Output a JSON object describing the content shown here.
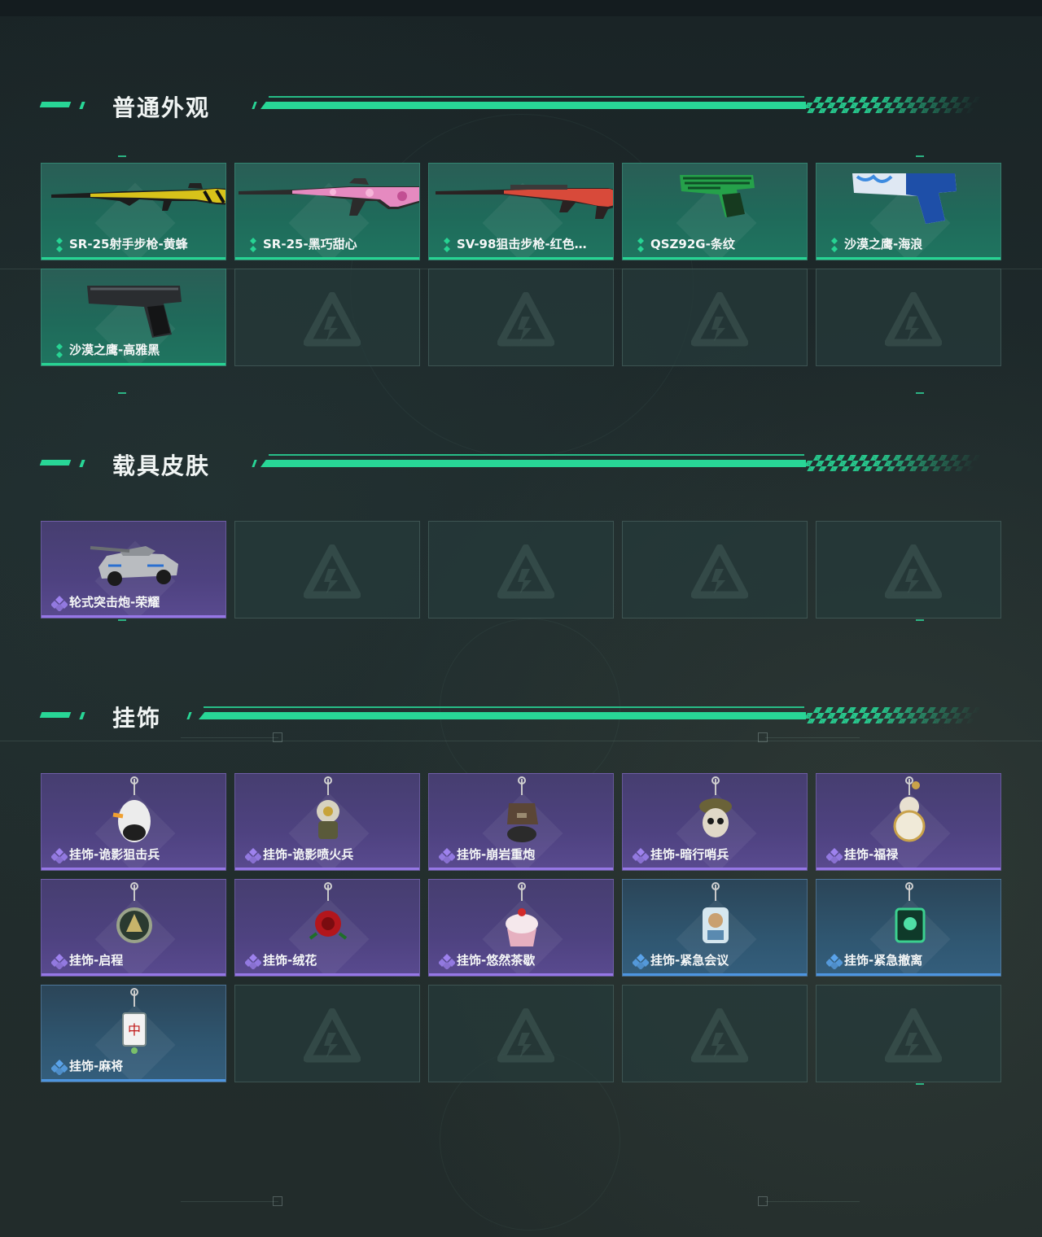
{
  "sections": [
    {
      "title": "普通外观",
      "items": [
        {
          "label": "SR-25射手步枪-黄蜂",
          "rarity": "green",
          "icon": "rifle-yellow-icon"
        },
        {
          "label": "SR-25-黑巧甜心",
          "rarity": "green",
          "icon": "rifle-pink-icon"
        },
        {
          "label": "SV-98狙击步枪-红色…",
          "rarity": "green",
          "icon": "sniper-red-icon"
        },
        {
          "label": "QSZ92G-条纹",
          "rarity": "green",
          "icon": "pistol-green-icon"
        },
        {
          "label": "沙漠之鹰-海浪",
          "rarity": "green",
          "icon": "pistol-blue-icon"
        },
        {
          "label": "沙漠之鹰-高雅黑",
          "rarity": "green",
          "icon": "pistol-black-icon"
        }
      ]
    },
    {
      "title": "载具皮肤",
      "items": [
        {
          "label": "轮式突击炮-荣耀",
          "rarity": "purple",
          "icon": "armored-vehicle-icon"
        }
      ]
    },
    {
      "title": "挂饰",
      "items": [
        {
          "label": "挂饰-诡影狙击兵",
          "rarity": "purple",
          "icon": "charm-ghost-sniper-icon"
        },
        {
          "label": "挂饰-诡影喷火兵",
          "rarity": "purple",
          "icon": "charm-ghost-flamer-icon"
        },
        {
          "label": "挂饰-崩岩重炮",
          "rarity": "purple",
          "icon": "charm-heavy-gunner-icon"
        },
        {
          "label": "挂饰-暗行哨兵",
          "rarity": "purple",
          "icon": "charm-sentinel-icon"
        },
        {
          "label": "挂饰-福禄",
          "rarity": "purple",
          "icon": "charm-gourd-icon"
        },
        {
          "label": "挂饰-启程",
          "rarity": "purple",
          "icon": "charm-compass-icon"
        },
        {
          "label": "挂饰-绒花",
          "rarity": "purple",
          "icon": "charm-rose-icon"
        },
        {
          "label": "挂饰-悠然茶歇",
          "rarity": "purple",
          "icon": "charm-cupcake-icon"
        },
        {
          "label": "挂饰-紧急会议",
          "rarity": "blue",
          "icon": "charm-figure-icon"
        },
        {
          "label": "挂饰-紧急撤离",
          "rarity": "blue",
          "icon": "charm-skull-card-icon"
        },
        {
          "label": "挂饰-麻将",
          "rarity": "blue",
          "icon": "charm-mahjong-icon"
        }
      ]
    }
  ],
  "colors": {
    "accent": "#28d696",
    "green_rarity": "#27d493",
    "purple_rarity": "#9677e6",
    "blue_rarity": "#4d95e0"
  }
}
